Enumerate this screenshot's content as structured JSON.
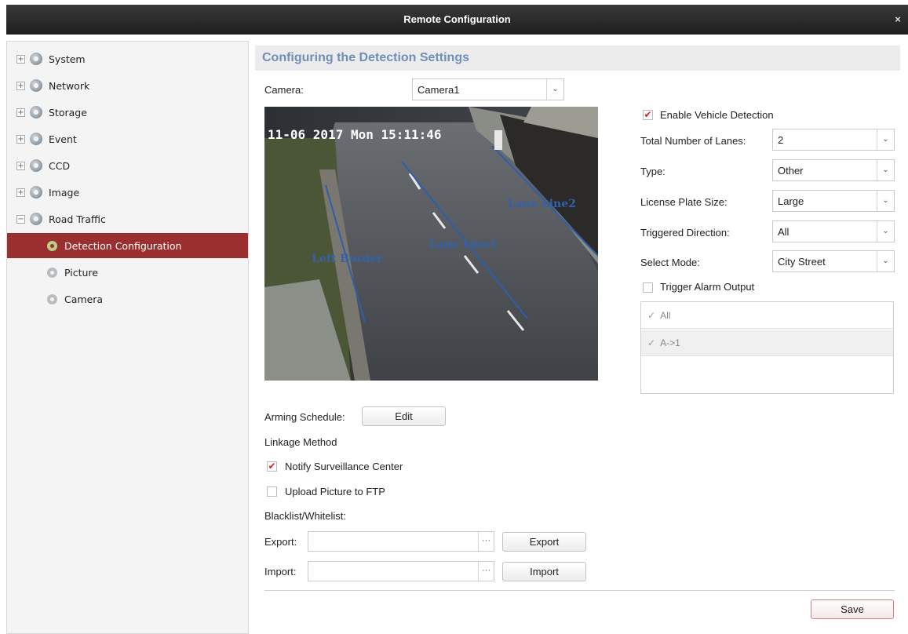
{
  "window": {
    "title": "Remote Configuration",
    "close": "×"
  },
  "sidebar": {
    "items": [
      {
        "label": "System",
        "expander": "+"
      },
      {
        "label": "Network",
        "expander": "+"
      },
      {
        "label": "Storage",
        "expander": "+"
      },
      {
        "label": "Event",
        "expander": "+"
      },
      {
        "label": "CCD",
        "expander": "+"
      },
      {
        "label": "Image",
        "expander": "+"
      },
      {
        "label": "Road Traffic",
        "expander": "−"
      }
    ],
    "children": [
      {
        "label": "Detection Configuration",
        "active": true
      },
      {
        "label": "Picture",
        "active": false
      },
      {
        "label": "Camera",
        "active": false
      }
    ]
  },
  "main": {
    "heading": "Configuring the Detection Settings",
    "camera_label": "Camera:",
    "camera_value": "Camera1",
    "video": {
      "timestamp": "11-06 2017 Mon 15:11:46",
      "overlays": [
        "Left Border",
        "Lane Line1",
        "Lane Line2"
      ]
    },
    "enable_vehicle_detection": {
      "label": "Enable Vehicle Detection",
      "checked": true
    },
    "fields": [
      {
        "label": "Total Number of Lanes:",
        "value": "2"
      },
      {
        "label": "Type:",
        "value": "Other"
      },
      {
        "label": "License Plate Size:",
        "value": "Large"
      },
      {
        "label": "Triggered Direction:",
        "value": "All"
      },
      {
        "label": "Select Mode:",
        "value": "City Street"
      }
    ],
    "trigger_alarm": {
      "label": "Trigger Alarm Output",
      "checked": false
    },
    "alarm_outputs": [
      "All",
      "A->1"
    ],
    "arming_schedule_label": "Arming Schedule:",
    "edit_button": "Edit",
    "linkage_method": "Linkage Method",
    "notify_center": {
      "label": "Notify Surveillance Center",
      "checked": true
    },
    "upload_ftp": {
      "label": "Upload Picture to FTP",
      "checked": false
    },
    "blacklist_label": "Blacklist/Whitelist:",
    "export_label": "Export:",
    "export_button": "Export",
    "import_label": "Import:",
    "import_button": "Import",
    "browse": "···",
    "save_button": "Save"
  },
  "icons": {
    "expander": "plus-minus-box-icon",
    "module": "gear-icon"
  },
  "colors": {
    "heading": "#6f8fb8",
    "active": "#9b2f2f",
    "check": "#d02020"
  }
}
